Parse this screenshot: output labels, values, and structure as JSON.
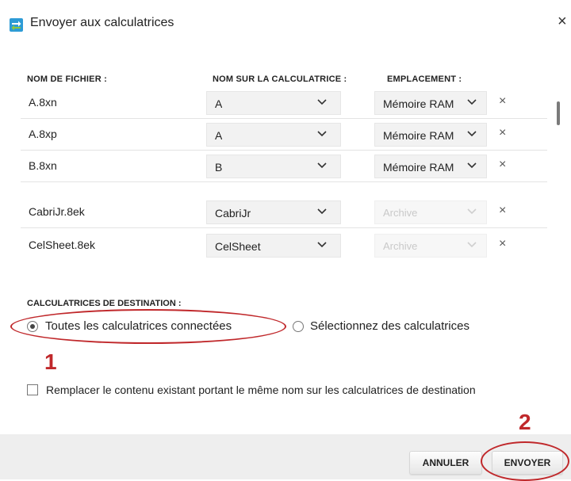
{
  "dialog": {
    "title": "Envoyer aux calculatrices",
    "close_glyph": "×"
  },
  "table": {
    "headers": {
      "filename": "NOM DE FICHIER :",
      "calc_name": "NOM SUR LA CALCULATRICE :",
      "location": "EMPLACEMENT :"
    },
    "rows": [
      {
        "filename": "A.8xn",
        "calc_name": "A",
        "location": "Mémoire RAM",
        "location_enabled": true
      },
      {
        "filename": "A.8xp",
        "calc_name": "A",
        "location": "Mémoire RAM",
        "location_enabled": true
      },
      {
        "filename": "B.8xn",
        "calc_name": "B",
        "location": "Mémoire RAM",
        "location_enabled": true
      },
      {
        "filename": "CabriJr.8ek",
        "calc_name": "CabriJr",
        "location": "Archive",
        "location_enabled": false
      },
      {
        "filename": "CelSheet.8ek",
        "calc_name": "CelSheet",
        "location": "Archive",
        "location_enabled": false
      }
    ],
    "delete_glyph": "×"
  },
  "destination": {
    "label": "CALCULATRICES DE DESTINATION :",
    "options": [
      {
        "label": "Toutes les calculatrices connectées",
        "selected": true
      },
      {
        "label": "Sélectionnez des calculatrices",
        "selected": false
      }
    ]
  },
  "replace": {
    "label": "Remplacer le contenu existant portant le même nom sur les calculatrices de destination",
    "checked": false
  },
  "buttons": {
    "cancel": "ANNULER",
    "send": "ENVOYER"
  },
  "annotations": {
    "step1": "1",
    "step2": "2",
    "color": "#c0282b"
  },
  "icons": {
    "app": "send-to-calculator-icon",
    "chevron": "chevron-down-icon",
    "close": "close-icon",
    "delete": "remove-row-icon"
  }
}
